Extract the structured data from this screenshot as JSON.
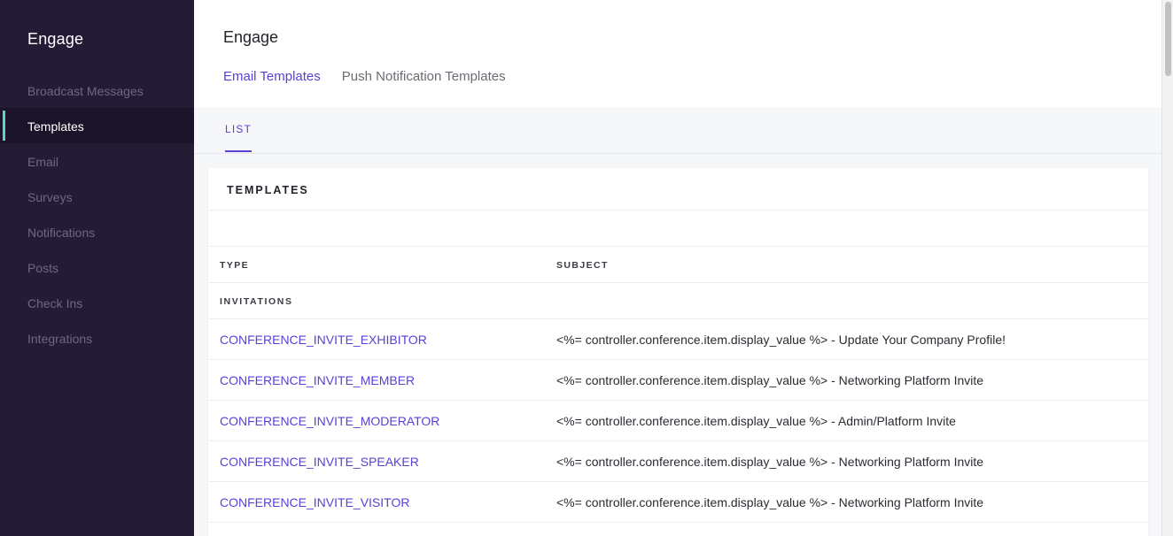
{
  "sidebar": {
    "brand": "Engage",
    "items": [
      {
        "label": "Broadcast Messages",
        "active": false
      },
      {
        "label": "Templates",
        "active": true
      },
      {
        "label": "Email",
        "active": false
      },
      {
        "label": "Surveys",
        "active": false
      },
      {
        "label": "Notifications",
        "active": false
      },
      {
        "label": "Posts",
        "active": false
      },
      {
        "label": "Check Ins",
        "active": false
      },
      {
        "label": "Integrations",
        "active": false
      }
    ]
  },
  "header": {
    "title": "Engage",
    "tabs": [
      {
        "label": "Email Templates",
        "active": true
      },
      {
        "label": "Push Notification Templates",
        "active": false
      }
    ]
  },
  "subtabs": {
    "list": "LIST"
  },
  "card": {
    "title": "TEMPLATES",
    "columns": {
      "type": "TYPE",
      "subject": "SUBJECT"
    },
    "group": "INVITATIONS",
    "rows": [
      {
        "type": "CONFERENCE_INVITE_EXHIBITOR",
        "subject": "<%= controller.conference.item.display_value %> - Update Your Company Profile!"
      },
      {
        "type": "CONFERENCE_INVITE_MEMBER",
        "subject": "<%= controller.conference.item.display_value %> - Networking Platform Invite"
      },
      {
        "type": "CONFERENCE_INVITE_MODERATOR",
        "subject": "<%= controller.conference.item.display_value %> - Admin/Platform Invite"
      },
      {
        "type": "CONFERENCE_INVITE_SPEAKER",
        "subject": "<%= controller.conference.item.display_value %> - Networking Platform Invite"
      },
      {
        "type": "CONFERENCE_INVITE_VISITOR",
        "subject": "<%= controller.conference.item.display_value %> - Networking Platform Invite"
      }
    ]
  },
  "colors": {
    "sidebar_bg": "#241b35",
    "accent": "#5a3fd6",
    "active_indicator": "#5fd3c6"
  }
}
